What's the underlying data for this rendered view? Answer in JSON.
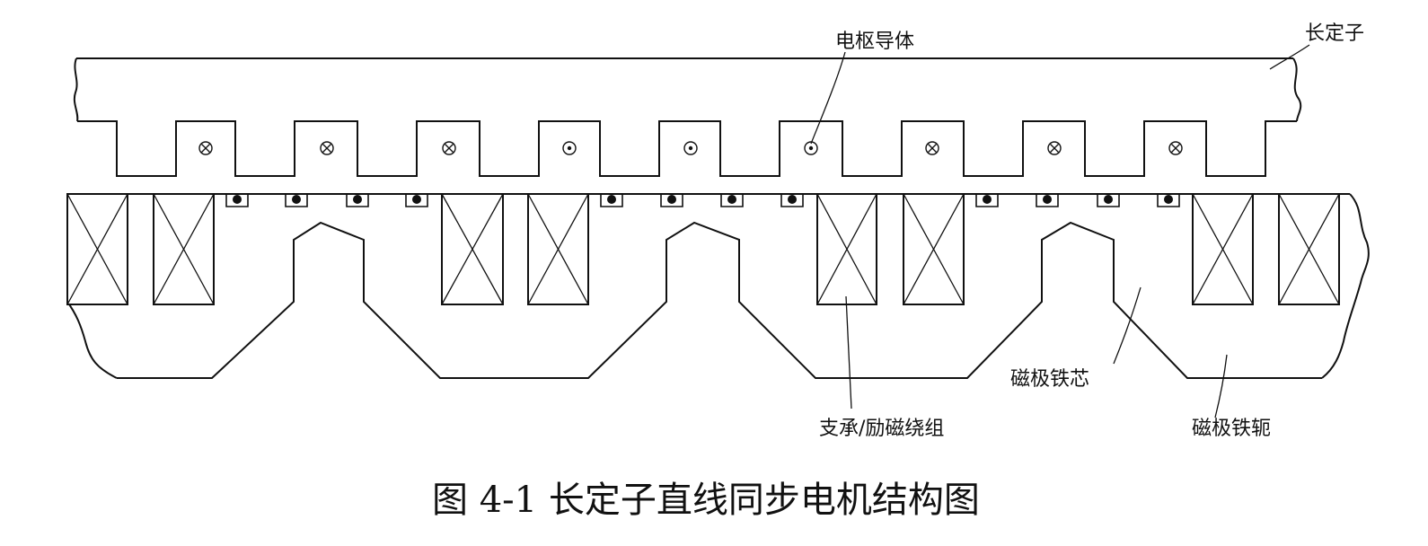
{
  "labels": {
    "long_stator": "长定子",
    "armature_conductor": "电枢导体",
    "support_excitation_winding": "支承/励磁绕组",
    "pole_core": "磁极铁芯",
    "pole_yoke": "磁极铁轭"
  },
  "caption": "图 4-1  长定子直线同步电机结构图",
  "armature_conductors": {
    "directions": [
      "into",
      "into",
      "into",
      "out",
      "out",
      "out",
      "into",
      "into",
      "into"
    ]
  },
  "colors": {
    "line": "#111111",
    "background": "#ffffff"
  }
}
